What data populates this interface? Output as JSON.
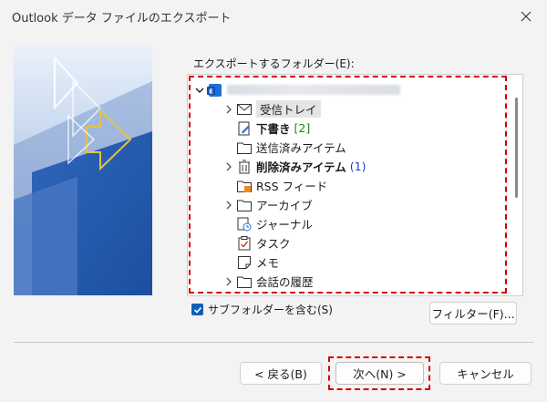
{
  "window": {
    "title": "Outlook データ ファイルのエクスポート"
  },
  "prompt_label": "エクスポートするフォルダー(E):",
  "tree": {
    "root": {
      "icon": "exchange-account-icon",
      "label": ""
    },
    "items": [
      {
        "label": "受信トレイ",
        "icon": "envelope-icon",
        "expandable": true,
        "selected": true,
        "bold": false,
        "count": ""
      },
      {
        "label": "下書き",
        "icon": "draft-icon",
        "expandable": false,
        "selected": false,
        "bold": true,
        "count": "[2]"
      },
      {
        "label": "送信済みアイテム",
        "icon": "folder-icon",
        "expandable": false,
        "selected": false,
        "bold": false,
        "count": ""
      },
      {
        "label": "削除済みアイテム",
        "icon": "trash-icon",
        "expandable": true,
        "selected": false,
        "bold": true,
        "count": "(1)"
      },
      {
        "label": "RSS フィード",
        "icon": "rss-folder-icon",
        "expandable": false,
        "selected": false,
        "bold": false,
        "count": ""
      },
      {
        "label": "アーカイブ",
        "icon": "folder-icon",
        "expandable": true,
        "selected": false,
        "bold": false,
        "count": ""
      },
      {
        "label": "ジャーナル",
        "icon": "journal-icon",
        "expandable": false,
        "selected": false,
        "bold": false,
        "count": ""
      },
      {
        "label": "タスク",
        "icon": "task-icon",
        "expandable": false,
        "selected": false,
        "bold": false,
        "count": ""
      },
      {
        "label": "メモ",
        "icon": "note-icon",
        "expandable": false,
        "selected": false,
        "bold": false,
        "count": ""
      },
      {
        "label": "会話の履歴",
        "icon": "folder-icon",
        "expandable": true,
        "selected": false,
        "bold": false,
        "count": ""
      }
    ]
  },
  "options": {
    "include_subfolders_label": "サブフォルダーを含む(S)",
    "include_subfolders_checked": true
  },
  "buttons": {
    "filter": "フィルター(F)...",
    "back": "< 戻る(B)",
    "next": "次へ(N) >",
    "cancel": "キャンセル"
  },
  "colors": {
    "accent": "#0f5fb8",
    "highlight_dash": "#d40000",
    "count_green": "#1a8a1a",
    "count_blue": "#1a3fd6"
  }
}
